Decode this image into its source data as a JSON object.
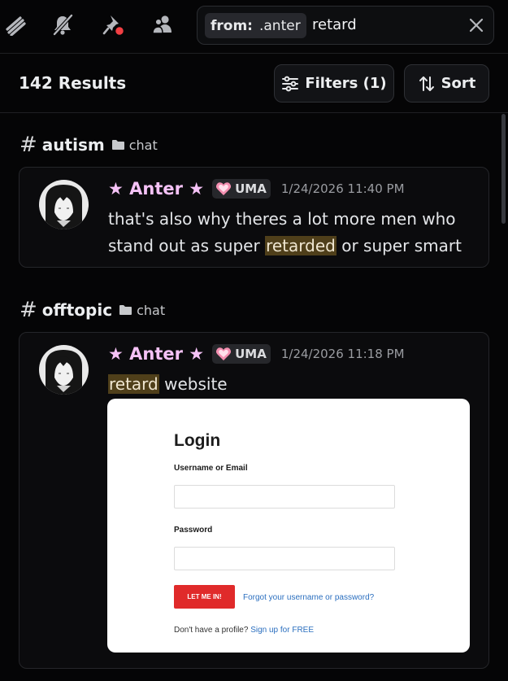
{
  "toolbar": {
    "icons": [
      "threads-icon",
      "notifications-muted-icon",
      "pinned-messages-icon",
      "member-list-icon"
    ]
  },
  "search": {
    "filter_key": "from:",
    "filter_value": ".anter",
    "query": "retard"
  },
  "results": {
    "count_label": "142 Results",
    "filters_label": "Filters (1)",
    "sort_label": "Sort"
  },
  "groups": [
    {
      "channel": "autism",
      "category": "chat",
      "message": {
        "author": "★ Anter ★",
        "tag": "UMA",
        "timestamp": "1/24/2026 11:40 PM",
        "text_before": "that's also why theres a lot more men who stand out as super ",
        "highlight": "retarded",
        "text_after": " or super smart"
      }
    },
    {
      "channel": "offtopic",
      "category": "chat",
      "message": {
        "author": "★ Anter ★",
        "tag": "UMA",
        "timestamp": "1/24/2026 11:18 PM",
        "text_before": "",
        "highlight": "retard",
        "text_after": " website",
        "attachment": {
          "title": "Login",
          "username_label": "Username or Email",
          "password_label": "Password",
          "submit_label": "LET ME IN!",
          "forgot_link": "Forgot your username or password?",
          "footer_text": "Don't have a profile?",
          "footer_link": "Sign up for FREE"
        }
      }
    }
  ],
  "colors": {
    "background": "#050506",
    "author": "#f5c2f6",
    "highlight": "#4f3f1a",
    "login_button": "#e02a2a",
    "link": "#2b6fbf"
  }
}
